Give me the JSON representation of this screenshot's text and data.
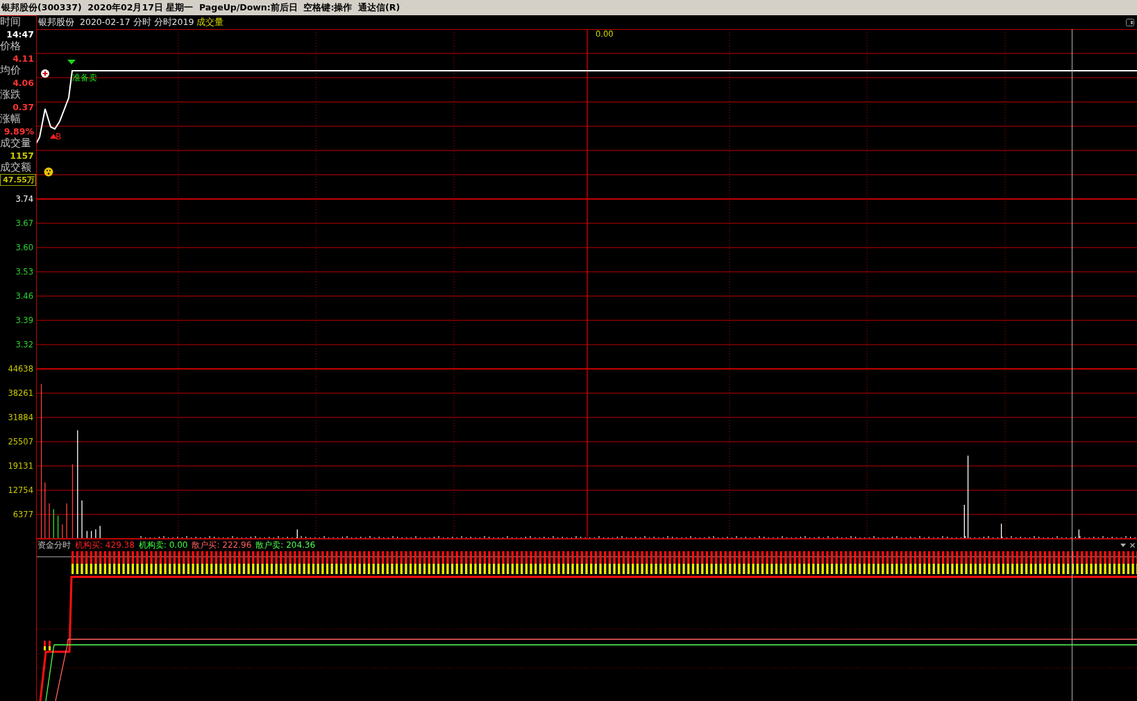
{
  "title_bar": {
    "title": "银邦股份(300337)  2020年02月17日 星期一  PageUp/Down:前后日  空格键:操作  通达信(R)"
  },
  "chart_header": {
    "stock": "银邦股份",
    "info": "2020-02-17 分时 分时2019",
    "indicator": "成交量"
  },
  "quote_panel": [
    {
      "label": "时间",
      "value": "14:47",
      "kind": "time"
    },
    {
      "label": "价格",
      "value": "4.11",
      "kind": "up"
    },
    {
      "label": "均价",
      "value": "4.06",
      "kind": "up"
    },
    {
      "label": "涨跌",
      "value": "0.37",
      "kind": "up"
    },
    {
      "label": "涨幅",
      "value": "9.89%",
      "kind": "up"
    },
    {
      "label": "成交量",
      "value": "1157",
      "kind": "volume"
    },
    {
      "label": "成交额",
      "value": "47.55万",
      "kind": "amount"
    }
  ],
  "axis_labels": [
    {
      "text": "3.74",
      "kind": "base"
    },
    {
      "text": "3.67",
      "kind": "down"
    },
    {
      "text": "3.60",
      "kind": "down"
    },
    {
      "text": "3.53",
      "kind": "down"
    },
    {
      "text": "3.46",
      "kind": "down"
    },
    {
      "text": "3.39",
      "kind": "down"
    },
    {
      "text": "3.32",
      "kind": "down"
    },
    {
      "text": "44638",
      "kind": "volume"
    },
    {
      "text": "38261",
      "kind": "volume"
    },
    {
      "text": "31884",
      "kind": "volume"
    },
    {
      "text": "25507",
      "kind": "volume"
    },
    {
      "text": "19131",
      "kind": "volume"
    },
    {
      "text": "12754",
      "kind": "volume"
    },
    {
      "text": "6377",
      "kind": "volume"
    }
  ],
  "price_chart": {
    "center_label": "0.00",
    "sell_signal": "准备卖",
    "buy_signal": "B"
  },
  "fund_flow": {
    "title": "资金分时",
    "items": [
      {
        "label": "机构买: 429.38",
        "kind": "inst_buy"
      },
      {
        "label": "机构卖: 0.00",
        "kind": "inst_sell"
      },
      {
        "label": "散户买: 222.96",
        "kind": "retail_buy"
      },
      {
        "label": "散户卖: 204.36",
        "kind": "retail_sell"
      }
    ]
  }
}
